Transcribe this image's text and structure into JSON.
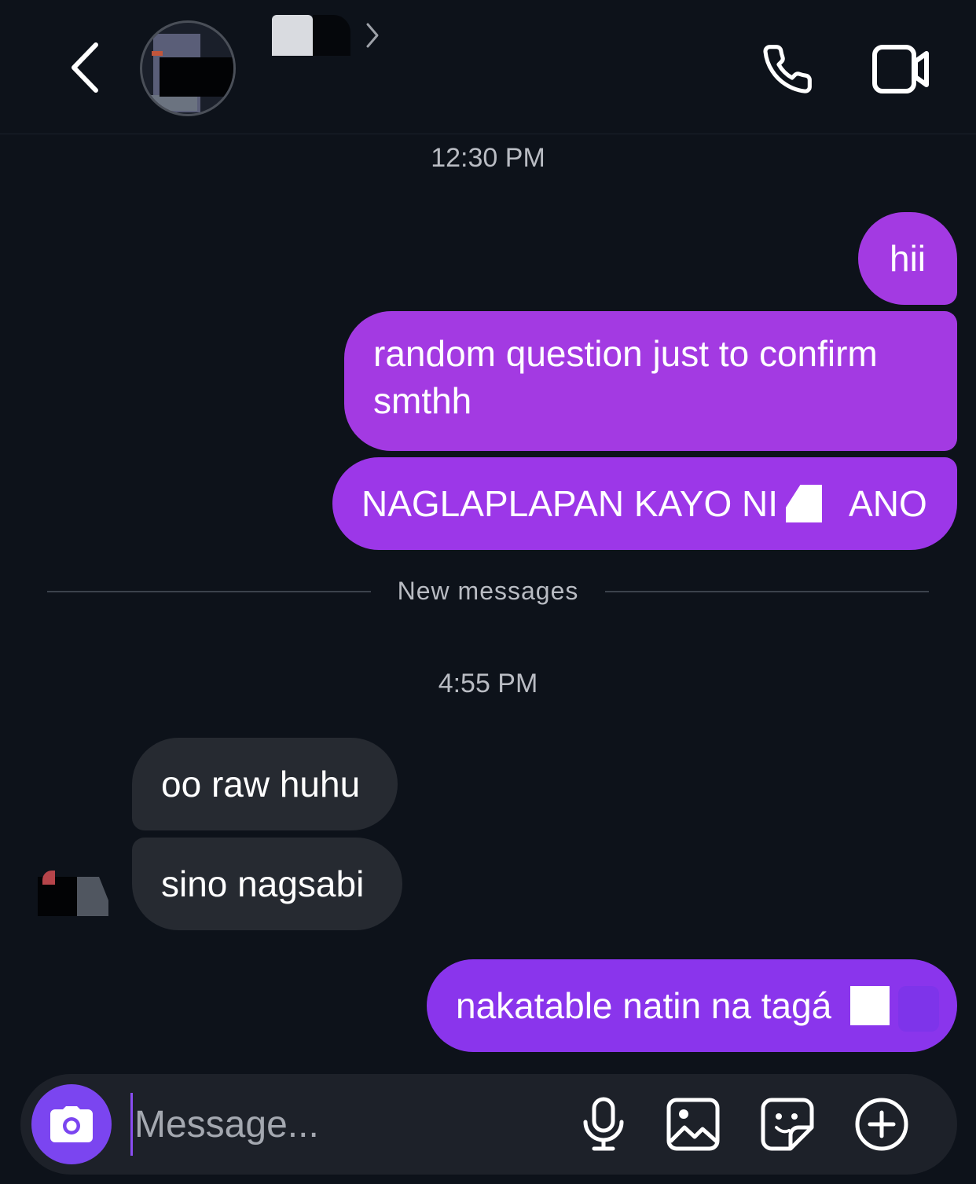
{
  "header": {
    "back_icon": "chevron-left-icon",
    "contact_chevron_icon": "chevron-right-icon",
    "call_icon": "phone-icon",
    "video_icon": "video-camera-icon"
  },
  "conversation": {
    "timestamps": [
      "12:30 PM",
      "4:55 PM"
    ],
    "outgoing_first": [
      {
        "text": "hii"
      },
      {
        "text": "random question just to confirm smthh"
      },
      {
        "text_before": "NAGLAPLAPAN KAYO NI",
        "text_after": "ANO"
      }
    ],
    "divider_label": "New messages",
    "incoming": [
      {
        "text": "oo raw huhu"
      },
      {
        "text": "sino nagsabi"
      }
    ],
    "outgoing_last": {
      "text": "nakatable natin na tagá"
    }
  },
  "composer": {
    "placeholder": "Message...",
    "camera_icon": "camera-icon",
    "mic_icon": "microphone-icon",
    "gallery_icon": "image-gallery-icon",
    "sticker_icon": "sticker-icon",
    "plus_icon": "plus-circle-icon"
  },
  "colors": {
    "background": "#0d121a",
    "outgoing_bubble": "#a33ae2",
    "incoming_bubble": "#262a31",
    "composer_accent": "#7b45f0"
  }
}
